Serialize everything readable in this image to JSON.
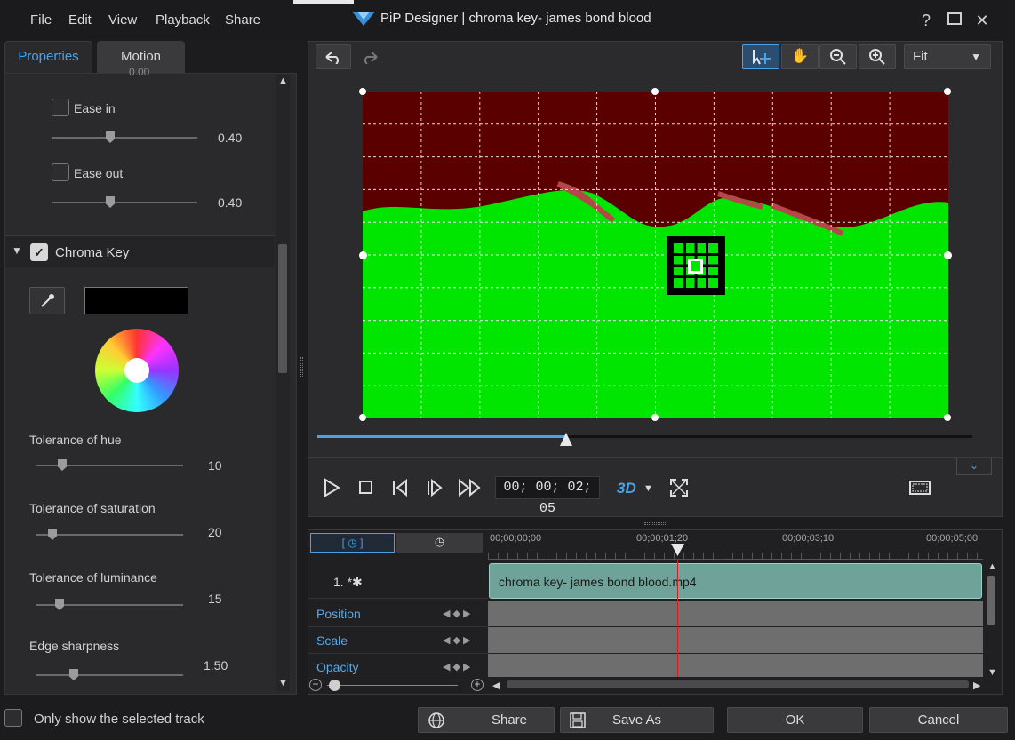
{
  "menu": {
    "file": "File",
    "edit": "Edit",
    "view": "View",
    "playback": "Playback",
    "share": "Share"
  },
  "window": {
    "title": "PiP Designer  |  chroma key- james bond blood",
    "help": "?",
    "maximize": "☐",
    "close": "✕"
  },
  "tabs": {
    "properties": "Properties",
    "motion": "Motion"
  },
  "properties": {
    "partial_value": "0.00",
    "ease_in": {
      "label": "Ease in",
      "value": "0.40",
      "checked": false
    },
    "ease_out": {
      "label": "Ease out",
      "value": "0.40",
      "checked": false
    },
    "chroma_key": {
      "label": "Chroma Key",
      "checked": true,
      "color": "#000000"
    },
    "tolerance_hue": {
      "label": "Tolerance of hue",
      "value": "10"
    },
    "tolerance_saturation": {
      "label": "Tolerance of saturation",
      "value": "20"
    },
    "tolerance_luminance": {
      "label": "Tolerance of luminance",
      "value": "15"
    },
    "edge_sharpness": {
      "label": "Edge sharpness",
      "value": "1.50"
    }
  },
  "preview": {
    "zoom": "Fit",
    "timecode": "00; 00; 02; 05",
    "mode_3d": "3D",
    "progress": 0.38,
    "colors": {
      "blood": "#5a0000",
      "green": "#00e600",
      "accent": "#4aa3e8"
    }
  },
  "timeline": {
    "ruler": [
      "00;00;00;00",
      "00;00;01;20",
      "00;00;03;10",
      "00;00;05;00"
    ],
    "track_name": "1. *✱",
    "clip": "chroma key- james bond blood.mp4",
    "rows": [
      "Position",
      "Scale",
      "Opacity"
    ]
  },
  "footer": {
    "only_selected": "Only show the selected track",
    "share": "Share",
    "save_as": "Save As",
    "ok": "OK",
    "cancel": "Cancel"
  }
}
